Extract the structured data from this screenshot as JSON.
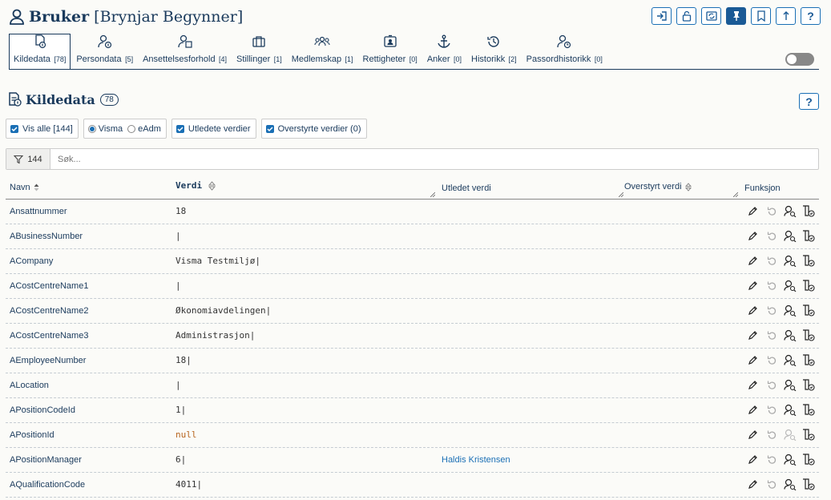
{
  "header": {
    "title": "Bruker",
    "name": "[Brynjar Begynner]",
    "help": "?"
  },
  "tabs": [
    {
      "label": "Kildedata",
      "count": "[78]",
      "icon": "source-doc-icon",
      "active": true
    },
    {
      "label": "Persondata",
      "count": "[5]",
      "icon": "person-info-icon"
    },
    {
      "label": "Ansettelsesforhold",
      "count": "[4]",
      "icon": "person-building-icon"
    },
    {
      "label": "Stillinger",
      "count": "[1]",
      "icon": "briefcase-icon"
    },
    {
      "label": "Medlemskap",
      "count": "[1]",
      "icon": "group-icon"
    },
    {
      "label": "Rettigheter",
      "count": "[0]",
      "icon": "id-badge-icon"
    },
    {
      "label": "Anker",
      "count": "[0]",
      "icon": "anchor-icon"
    },
    {
      "label": "Historikk",
      "count": "[2]",
      "icon": "history-icon"
    },
    {
      "label": "Passordhistorikk",
      "count": "[0]",
      "icon": "person-clock-icon"
    }
  ],
  "section": {
    "title": "Kildedata",
    "badge": "78",
    "help": "?"
  },
  "filters": {
    "show_all": "Vis alle [144]",
    "visma": "Visma",
    "eadm": "eAdm",
    "derived": "Utledete verdier",
    "overridden": "Overstyrte verdier (0)"
  },
  "search": {
    "count": "144",
    "placeholder": "Søk..."
  },
  "columns": {
    "name": "Navn",
    "value": "Verdi",
    "derived": "Utledet verdi",
    "overridden": "Overstyrt verdi",
    "function": "Funksjon"
  },
  "rows": [
    {
      "name": "Ansattnummer",
      "value": "18",
      "derived": ""
    },
    {
      "name": "ABusinessNumber",
      "value": "|",
      "derived": ""
    },
    {
      "name": "ACompany",
      "value": "Visma Testmiljø|",
      "derived": ""
    },
    {
      "name": "ACostCentreName1",
      "value": "|",
      "derived": ""
    },
    {
      "name": "ACostCentreName2",
      "value": "Økonomiavdelingen|",
      "derived": ""
    },
    {
      "name": "ACostCentreName3",
      "value": "Administrasjon|",
      "derived": ""
    },
    {
      "name": "AEmployeeNumber",
      "value": "18|",
      "derived": ""
    },
    {
      "name": "ALocation",
      "value": "|",
      "derived": ""
    },
    {
      "name": "APositionCodeId",
      "value": "1|",
      "derived": ""
    },
    {
      "name": "APositionId",
      "value": "null",
      "derived": ""
    },
    {
      "name": "APositionManager",
      "value": "6|",
      "derived": "Haldis Kristensen"
    },
    {
      "name": "AQualificationCode",
      "value": "4011|",
      "derived": ""
    }
  ],
  "colors": {
    "primary": "#1a3a5c",
    "accent": "#1a6fb5",
    "null_value": "#b8651e"
  }
}
